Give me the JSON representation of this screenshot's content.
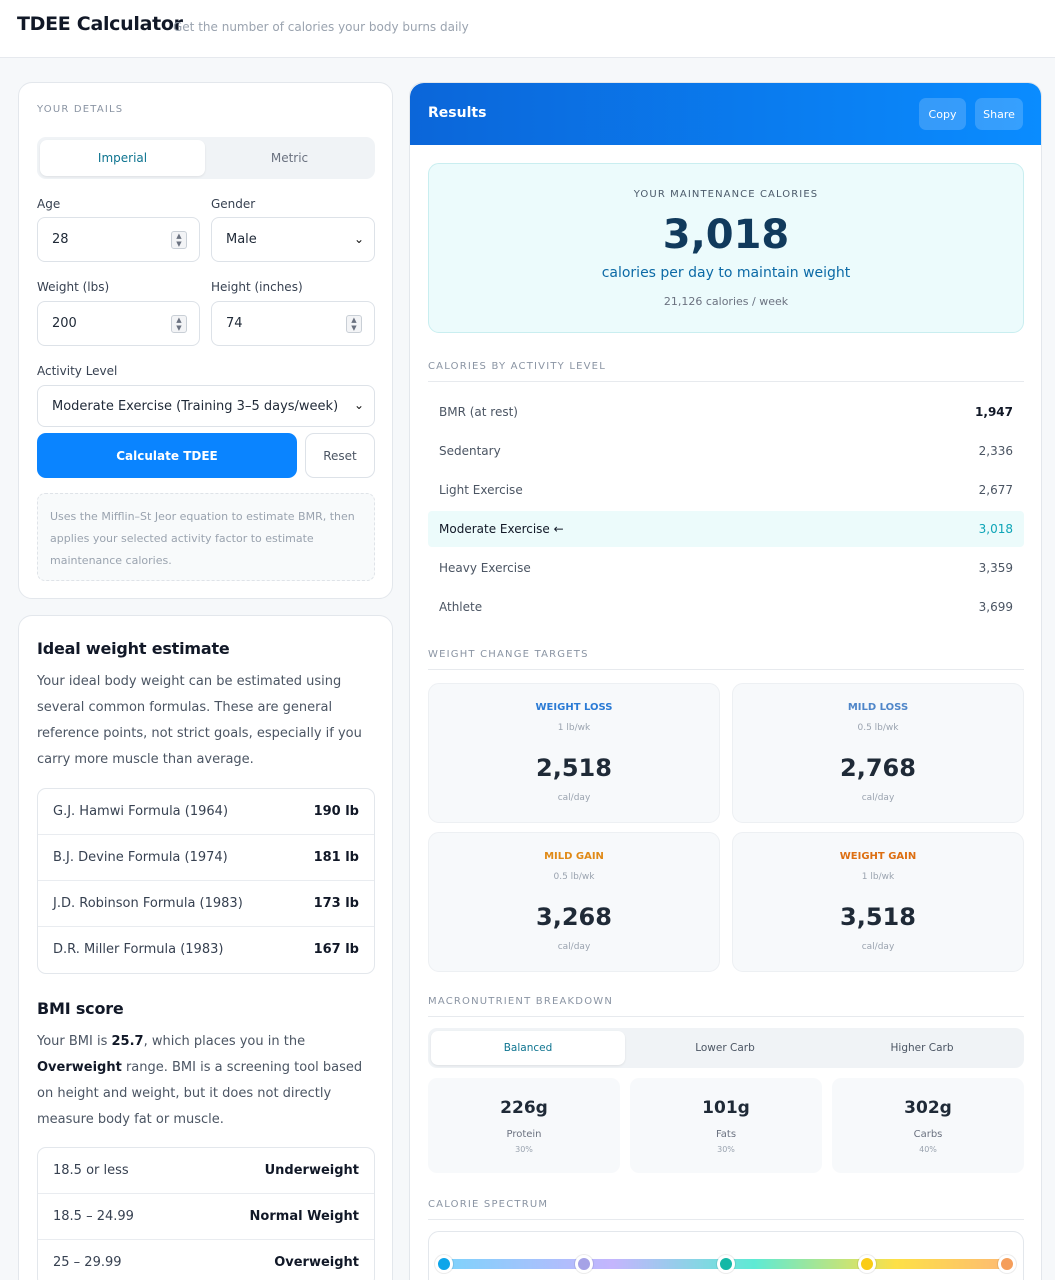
{
  "header": {
    "title": "TDEE Calculator",
    "subtitle": "Get the number of calories your body burns daily"
  },
  "details": {
    "section_label": "YOUR DETAILS",
    "units": [
      "Imperial",
      "Metric"
    ],
    "active_unit": "Imperial",
    "age_label": "Age",
    "age_value": "28",
    "gender_label": "Gender",
    "gender_value": "Male",
    "weight_label": "Weight (lbs)",
    "weight_value": "200",
    "height_label": "Height (inches)",
    "height_value": "74",
    "activity_label": "Activity Level",
    "activity_value": "Moderate Exercise (Training 3–5 days/week)",
    "calculate_label": "Calculate TDEE",
    "reset_label": "Reset",
    "note": "Uses the Mifflin–St Jeor equation to estimate BMR, then applies your selected activity factor to estimate maintenance calories."
  },
  "ideal": {
    "title": "Ideal weight estimate",
    "intro": "Your ideal body weight can be estimated using several common formulas. These are general reference points, not strict goals, especially if you carry more muscle than average.",
    "formulas": [
      {
        "name": "G.J. Hamwi Formula (1964)",
        "value": "190 lb"
      },
      {
        "name": "B.J. Devine Formula (1974)",
        "value": "181 lb"
      },
      {
        "name": "J.D. Robinson Formula (1983)",
        "value": "173 lb"
      },
      {
        "name": "D.R. Miller Formula (1983)",
        "value": "167 lb"
      }
    ]
  },
  "bmi": {
    "title": "BMI score",
    "text_1": "Your BMI is ",
    "value": "25.7",
    "text_2": ", which places you in the ",
    "category": "Overweight",
    "text_3": " range. BMI is a screening tool based on height and weight, but it does not directly measure body fat or muscle.",
    "ranges": [
      {
        "range": "18.5 or less",
        "label": "Underweight"
      },
      {
        "range": "18.5 – 24.99",
        "label": "Normal Weight"
      },
      {
        "range": "25 – 29.99",
        "label": "Overweight"
      }
    ]
  },
  "results": {
    "title": "Results",
    "copy_label": "Copy",
    "share_label": "Share",
    "maintenance_caption": "YOUR MAINTENANCE CALORIES",
    "maintenance_value": "3,018",
    "maintenance_sub": "calories per day to maintain weight",
    "weekly": "21,126 calories / week",
    "activity_caption": "CALORIES BY ACTIVITY LEVEL",
    "activity_levels": [
      {
        "name": "BMR (at rest)",
        "value": "1,947"
      },
      {
        "name": "Sedentary",
        "value": "2,336"
      },
      {
        "name": "Light Exercise",
        "value": "2,677"
      },
      {
        "name": "Moderate Exercise ←",
        "value": "3,018"
      },
      {
        "name": "Heavy Exercise",
        "value": "3,359"
      },
      {
        "name": "Athlete",
        "value": "3,699"
      }
    ],
    "targets_caption": "WEIGHT CHANGE TARGETS",
    "targets": [
      {
        "title": "WEIGHT LOSS",
        "rate": "1 lb/wk",
        "value": "2,518",
        "unit": "cal/day",
        "color": "#2b7bd5"
      },
      {
        "title": "MILD LOSS",
        "rate": "0.5 lb/wk",
        "value": "2,768",
        "unit": "cal/day",
        "color": "#4f86c9"
      },
      {
        "title": "MILD GAIN",
        "rate": "0.5 lb/wk",
        "value": "3,268",
        "unit": "cal/day",
        "color": "#e08a17"
      },
      {
        "title": "WEIGHT GAIN",
        "rate": "1 lb/wk",
        "value": "3,518",
        "unit": "cal/day",
        "color": "#dd6f12"
      }
    ],
    "macro_caption": "MACRONUTRIENT BREAKDOWN",
    "macro_tabs": [
      "Balanced",
      "Lower Carb",
      "Higher Carb"
    ],
    "macro_active": "Balanced",
    "macros": [
      {
        "grams": "226g",
        "label": "Protein",
        "pct": "30%"
      },
      {
        "grams": "101g",
        "label": "Fats",
        "pct": "30%"
      },
      {
        "grams": "302g",
        "label": "Carbs",
        "pct": "40%"
      }
    ],
    "spectrum_caption": "CALORIE SPECTRUM",
    "spectrum_dot_colors": [
      "#0ea5e9",
      "#a5a2e6",
      "#14b8a6",
      "#facc15",
      "#f59e5b"
    ]
  }
}
